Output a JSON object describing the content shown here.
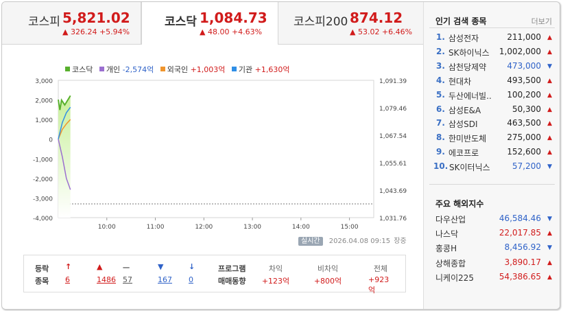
{
  "tabs": [
    {
      "name": "코스피",
      "value": "5,821.02",
      "change": "▲ 326.24 +5.94%"
    },
    {
      "name": "코스닥",
      "value": "1,084.73",
      "change": "▲ 48.00 +4.63%"
    },
    {
      "name": "코스피200",
      "value": "874.12",
      "change": "▲ 53.02 +6.46%"
    }
  ],
  "legend": [
    {
      "name": "코스닥",
      "value": "",
      "color": "#58b02d"
    },
    {
      "name": "개인",
      "value": "-2,574억",
      "color": "#9b6fd0"
    },
    {
      "name": "외국인",
      "value": "+1,003억",
      "color": "#f0952d"
    },
    {
      "name": "기관",
      "value": "+1,630억",
      "color": "#2f8fe6"
    }
  ],
  "chart_data": {
    "type": "line",
    "left_axis": {
      "ticks": [
        "3,000",
        "2,000",
        "1,000",
        "0",
        "-1,000",
        "-2,000",
        "-3,000",
        "-4,000"
      ],
      "range": [
        -4000,
        3000
      ]
    },
    "right_axis": {
      "ticks": [
        "1,091.39",
        "1,079.46",
        "1,067.54",
        "1,055.61",
        "1,043.69",
        "1,031.76"
      ],
      "range": [
        1031.76,
        1091.39
      ]
    },
    "x_ticks": [
      "10:00",
      "11:00",
      "12:00",
      "13:00",
      "14:00",
      "15:00"
    ],
    "x_range_minutes": [
      540,
      930
    ],
    "series": [
      {
        "name": "코스닥",
        "color": "#58b02d",
        "x": [
          540,
          542,
          544,
          548,
          555
        ],
        "y": [
          1083.0,
          1078.5,
          1082.8,
          1080.7,
          1084.73
        ],
        "area": true
      },
      {
        "name": "개인",
        "color": "#9b6fd0",
        "x": [
          540,
          545,
          550,
          555
        ],
        "y": [
          0,
          -900,
          -2000,
          -2574
        ]
      },
      {
        "name": "외국인",
        "color": "#f0952d",
        "x": [
          540,
          545,
          550,
          555
        ],
        "y": [
          0,
          500,
          780,
          1003
        ]
      },
      {
        "name": "기관",
        "color": "#2f8fe6",
        "x": [
          540,
          545,
          550,
          555
        ],
        "y": [
          0,
          850,
          1350,
          1630
        ]
      }
    ]
  },
  "realtime_label": "실시간",
  "timestamp": "2026.04.08 09:15",
  "market_status": "장중",
  "stats": {
    "row_label_top": "등락",
    "row_label_bottom": "종목",
    "items": [
      {
        "arrow": "↑",
        "count": "6",
        "color": "#d11b1b"
      },
      {
        "arrow": "▲",
        "count": "1486",
        "color": "#d11b1b"
      },
      {
        "arrow": "ㅡ",
        "count": "57",
        "color": "#555555"
      },
      {
        "arrow": "▼",
        "count": "167",
        "color": "#2f62c8"
      },
      {
        "arrow": "↓",
        "count": "0",
        "color": "#2f62c8"
      }
    ],
    "program_top": "프로그램",
    "program_bottom": "매매동향",
    "program_items": [
      {
        "label": "차익",
        "value": "+123억"
      },
      {
        "label": "비차익",
        "value": "+800억"
      },
      {
        "label": "전체",
        "value": "+923억"
      }
    ]
  },
  "popular": {
    "title": "인기 검색 종목",
    "more": "더보기",
    "items": [
      {
        "rank": "1.",
        "name": "삼성전자",
        "price": "211,000",
        "dir": "up"
      },
      {
        "rank": "2.",
        "name": "SK하이닉스",
        "price": "1,002,000",
        "dir": "up"
      },
      {
        "rank": "3.",
        "name": "삼천당제약",
        "price": "473,000",
        "dir": "down"
      },
      {
        "rank": "4.",
        "name": "현대차",
        "price": "493,500",
        "dir": "up"
      },
      {
        "rank": "5.",
        "name": "두산에너빌..",
        "price": "100,200",
        "dir": "up"
      },
      {
        "rank": "6.",
        "name": "삼성E&A",
        "price": "50,300",
        "dir": "up"
      },
      {
        "rank": "7.",
        "name": "삼성SDI",
        "price": "463,500",
        "dir": "up"
      },
      {
        "rank": "8.",
        "name": "한미반도체",
        "price": "275,000",
        "dir": "up"
      },
      {
        "rank": "9.",
        "name": "에코프로",
        "price": "152,600",
        "dir": "up"
      },
      {
        "rank": "10.",
        "name": "SK이터닉스",
        "price": "57,200",
        "dir": "down"
      }
    ]
  },
  "overseas": {
    "title": "주요 해외지수",
    "items": [
      {
        "name": "다우산업",
        "value": "46,584.46",
        "dir": "down"
      },
      {
        "name": "나스닥",
        "value": "22,017.85",
        "dir": "up"
      },
      {
        "name": "홍콩H",
        "value": "8,456.92",
        "dir": "down"
      },
      {
        "name": "상해종합",
        "value": "3,890.17",
        "dir": "up"
      },
      {
        "name": "니케이225",
        "value": "54,386.65",
        "dir": "up"
      }
    ]
  }
}
